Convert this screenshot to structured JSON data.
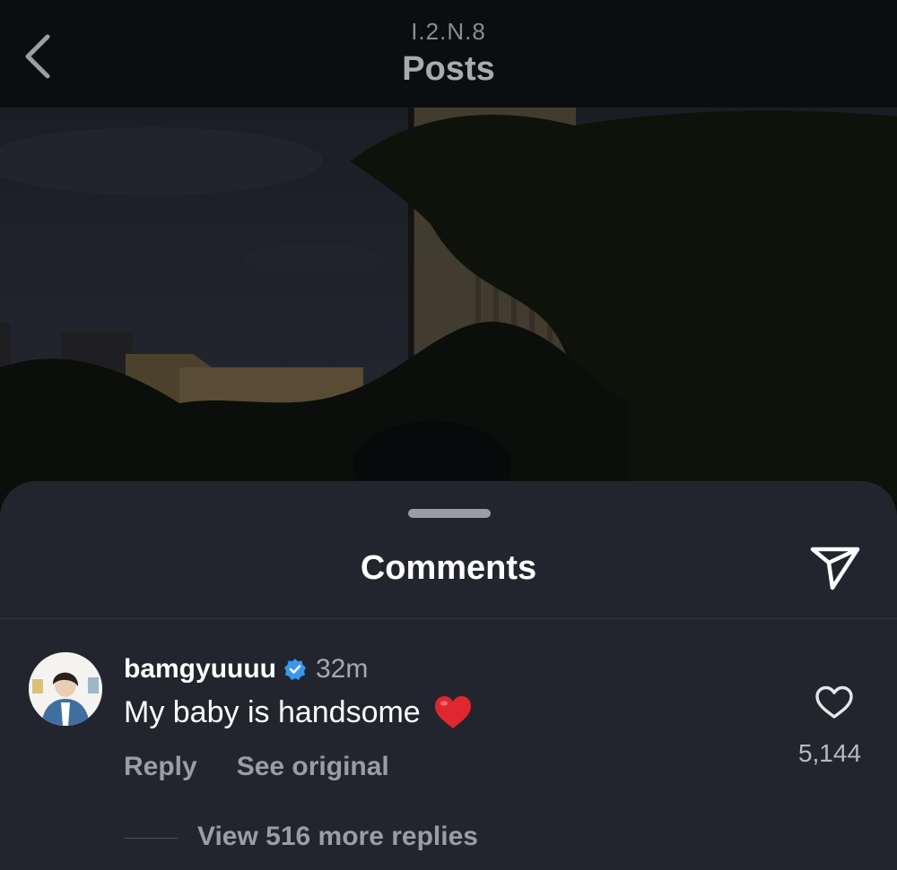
{
  "header": {
    "subtitle": "I.2.N.8",
    "title": "Posts",
    "back_icon": "chevron-left-icon"
  },
  "sheet": {
    "title": "Comments",
    "share_icon": "paper-plane-icon"
  },
  "comment": {
    "username": "bamgyuuuu",
    "verified": true,
    "time": "32m",
    "text": "My baby is handsome",
    "emoji": "red-heart",
    "actions": {
      "reply": "Reply",
      "see_original": "See original"
    },
    "like_count": "5,144",
    "view_replies": "View 516 more replies"
  },
  "colors": {
    "background": "#23252e",
    "verified_badge": "#3897f0",
    "heart_emoji": "#e0262f"
  }
}
